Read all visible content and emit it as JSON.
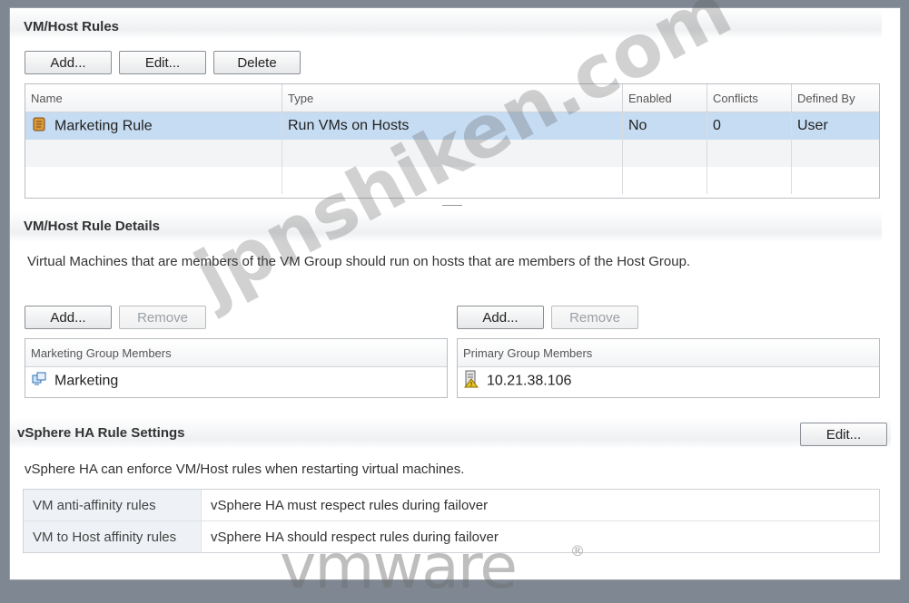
{
  "vm_host_rules": {
    "title": "VM/Host Rules",
    "buttons": {
      "add": "Add...",
      "edit": "Edit...",
      "delete": "Delete"
    },
    "columns": [
      "Name",
      "Type",
      "Enabled",
      "Conflicts",
      "Defined By"
    ],
    "rows": [
      {
        "name": "Marketing Rule",
        "type": "Run VMs on Hosts",
        "enabled": "No",
        "conflicts": "0",
        "defined_by": "User"
      }
    ]
  },
  "rule_details": {
    "title": "VM/Host Rule Details",
    "description": "Virtual Machines that are members of the VM Group should run on hosts that are members of the Host Group.",
    "left_buttons": {
      "add": "Add...",
      "remove": "Remove"
    },
    "right_buttons": {
      "add": "Add...",
      "remove": "Remove"
    },
    "vm_group_header": "Marketing Group Members",
    "vm_group_member": "Marketing",
    "host_group_header": "Primary Group Members",
    "host_group_member": "10.21.38.106"
  },
  "ha_settings": {
    "title": "vSphere HA Rule Settings",
    "edit_label": "Edit...",
    "description": "vSphere HA can enforce VM/Host rules when restarting virtual machines.",
    "rows": [
      {
        "key": "VM anti-affinity rules",
        "value": "vSphere HA must respect rules during failover"
      },
      {
        "key": "VM to Host affinity rules",
        "value": "vSphere HA should respect rules during failover"
      }
    ]
  },
  "watermarks": {
    "main": "jpnshiken.com",
    "brand": "vmware",
    "registered": "®"
  },
  "colors": {
    "selected_row": "#c6dcf2",
    "frame": "#7f8792",
    "warning_icon": "#e8c32a"
  },
  "icons": {
    "rule": "scroll-icon",
    "vm_group": "vm-group-icon",
    "host": "host-warning-icon"
  }
}
